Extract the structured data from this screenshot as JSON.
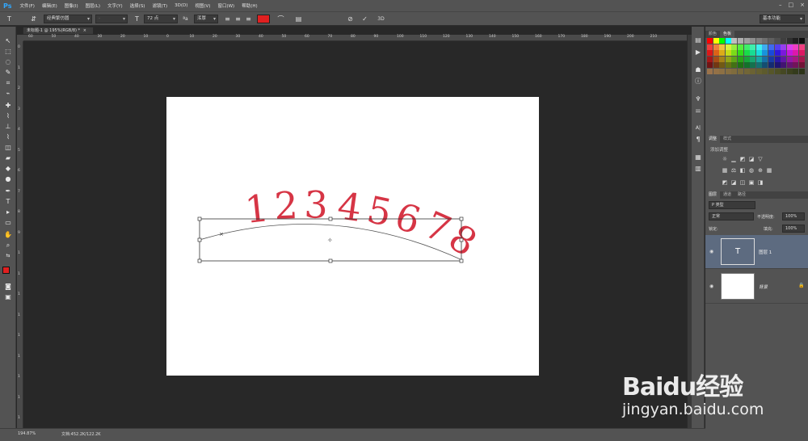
{
  "app": {
    "logo": "Ps",
    "menus": [
      "文件(F)",
      "编辑(E)",
      "图像(I)",
      "图层(L)",
      "文字(Y)",
      "选择(S)",
      "滤镜(T)",
      "3D(D)",
      "视图(V)",
      "窗口(W)",
      "帮助(H)"
    ],
    "window_controls": [
      "–",
      "□",
      "×"
    ]
  },
  "options": {
    "font_family": "经典繁仿圆",
    "font_style": "-",
    "font_size": "72 点",
    "antialias": "浑厚",
    "text_color": "#e02020",
    "workspace": "基本功能"
  },
  "document": {
    "tab_title": "未标题-1 @ 195%(RGB/8) *",
    "artwork_text": [
      "1",
      "2",
      "3",
      "4",
      "5",
      "6",
      "7",
      "8"
    ],
    "artwork_color": "#d63545"
  },
  "rulers": {
    "top": [
      "60",
      "50",
      "40",
      "30",
      "20",
      "10",
      "0",
      "10",
      "20",
      "30",
      "40",
      "50",
      "60",
      "70",
      "80",
      "90",
      "100",
      "110",
      "120",
      "130",
      "140",
      "150",
      "160",
      "170",
      "180",
      "190",
      "200",
      "210"
    ],
    "left": [
      "0",
      "1",
      "2",
      "3",
      "4",
      "5",
      "6",
      "7",
      "8",
      "9",
      "1",
      "1",
      "1",
      "1",
      "1",
      "1",
      "1",
      "1",
      "1"
    ]
  },
  "panels": {
    "color_tabs": [
      "颜色",
      "色板"
    ],
    "adjust_tabs": [
      "调整",
      "样式"
    ],
    "adjust_label": "添加调整",
    "layers_tabs": [
      "图层",
      "通道",
      "路径"
    ],
    "filter_kind": "P 类型",
    "blend_mode": "正常",
    "opacity_label": "不透明度:",
    "opacity_value": "100%",
    "lock_label": "锁定:",
    "fill_label": "填充:",
    "fill_value": "100%",
    "layers": [
      {
        "name": "图层 1",
        "thumb": "T"
      },
      {
        "name": "背景",
        "thumb": ""
      }
    ]
  },
  "status": {
    "zoom": "194.87%",
    "doc_info": "文档:452.2K/122.2K"
  },
  "watermark": {
    "brand": "Baidu经验",
    "url": "jingyan.baidu.com"
  }
}
